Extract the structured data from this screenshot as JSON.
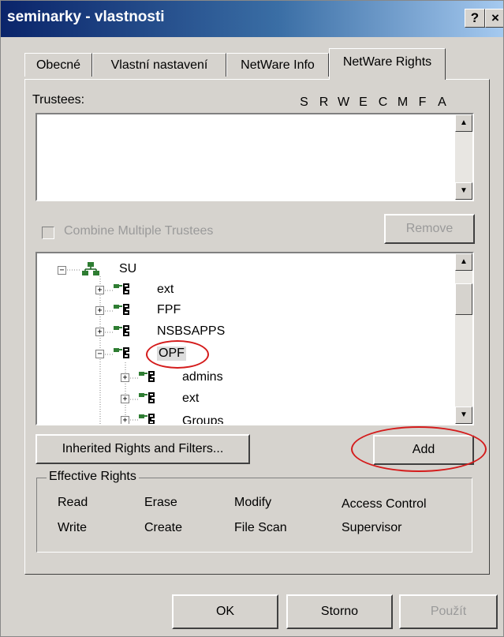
{
  "window": {
    "title": "seminarky - vlastnosti",
    "help_label": "?",
    "close_label": "×"
  },
  "tabs": [
    {
      "label": "Obecné"
    },
    {
      "label": "Vlastní nastavení"
    },
    {
      "label": "NetWare Info"
    },
    {
      "label": "NetWare Rights"
    }
  ],
  "trustees": {
    "label": "Trustees:",
    "rights_columns": [
      "S",
      "R",
      "W",
      "E",
      "C",
      "M",
      "F",
      "A"
    ]
  },
  "combine": {
    "label": "Combine Multiple Trustees",
    "checked": false
  },
  "remove_label": "Remove",
  "tree": [
    {
      "label": "SU"
    },
    {
      "label": "ext"
    },
    {
      "label": "FPF"
    },
    {
      "label": "NSBSAPPS"
    },
    {
      "label": "OPF"
    },
    {
      "label": "admins"
    },
    {
      "label": "ext"
    },
    {
      "label": "Groups"
    }
  ],
  "inherited_label": "Inherited Rights and Filters...",
  "add_label": "Add",
  "effective": {
    "title": "Effective Rights",
    "rights": [
      "Read",
      "Erase",
      "Modify",
      "Access Control",
      "Write",
      "Create",
      "File Scan",
      "Supervisor"
    ]
  },
  "footer": {
    "ok_label": "OK",
    "cancel_label": "Storno",
    "apply_label": "Použít"
  },
  "colors": {
    "titlebar_start": "#0a246a",
    "titlebar_end": "#a6caf0",
    "face": "#d6d3ce",
    "annotation": "#d41b1b"
  }
}
